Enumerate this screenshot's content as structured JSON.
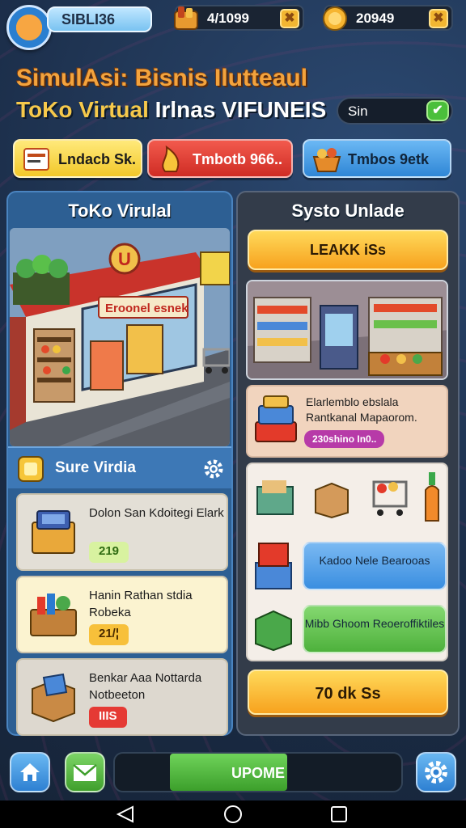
{
  "header": {
    "player_name": "SIBLI36",
    "resource1": {
      "value": "4/1099",
      "icon": "wood-crate-icon"
    },
    "resource2": {
      "value": "20949",
      "icon": "gold-coin-icon"
    }
  },
  "titles": {
    "line1": "SimulAsi: Bisnis Ilutteaul",
    "line2_highlight": "ToKo Virtual",
    "line2_rest": " Irlnas VIFUNEIS",
    "toggle_label": "Sin"
  },
  "tabs": [
    {
      "label": "Lndacb Sk.",
      "icon": "cart-icon",
      "color": "#f3d23b"
    },
    {
      "label": "Tmbotb 966..",
      "icon": "fire-icon",
      "color": "#e2342c"
    },
    {
      "label": "Tmbos 9etk",
      "icon": "food-basket-icon",
      "color": "#3d97e0"
    }
  ],
  "left_panel": {
    "title": "ToKo Virulal",
    "scene_sign": "Eroonel esnek",
    "sub_title": "Sure Virdia",
    "items": [
      {
        "title": "Dolon San Kdoitegi Elark",
        "price": "219",
        "badge_color": "#d8f2a0",
        "text_color": "#2f6b12",
        "card_bg": "#e3dfd6"
      },
      {
        "title": "Hanin Rathan stdia Robeka",
        "price": "21/¦",
        "badge_color": "#f7c03a",
        "text_color": "#4a2b00",
        "card_bg": "#fbf3d0"
      },
      {
        "title": "Benkar Aaa Nottarda Notbeeton",
        "price": "IIIS",
        "badge_color": "#e53a34",
        "text_color": "#ffffff",
        "card_bg": "#ddd8cf"
      }
    ]
  },
  "right_panel": {
    "title": "Systo Unlade",
    "top_button": "LEAKK iSs",
    "promo_text": "Elarlemblo ebslala Rantkanal Mapaorom.",
    "promo_badge": "230shino In0..",
    "grid_buttons": [
      {
        "label": "Kadoo Nele Bearooas",
        "color": "#4f9de6"
      },
      {
        "label": "Mibb Ghoom Reoeroffiktiles",
        "color": "#5fc44a"
      }
    ],
    "bottom_button": "70 dk Ss"
  },
  "bottom_bar": {
    "progress_label": "UPOME",
    "progress": 0.41
  }
}
